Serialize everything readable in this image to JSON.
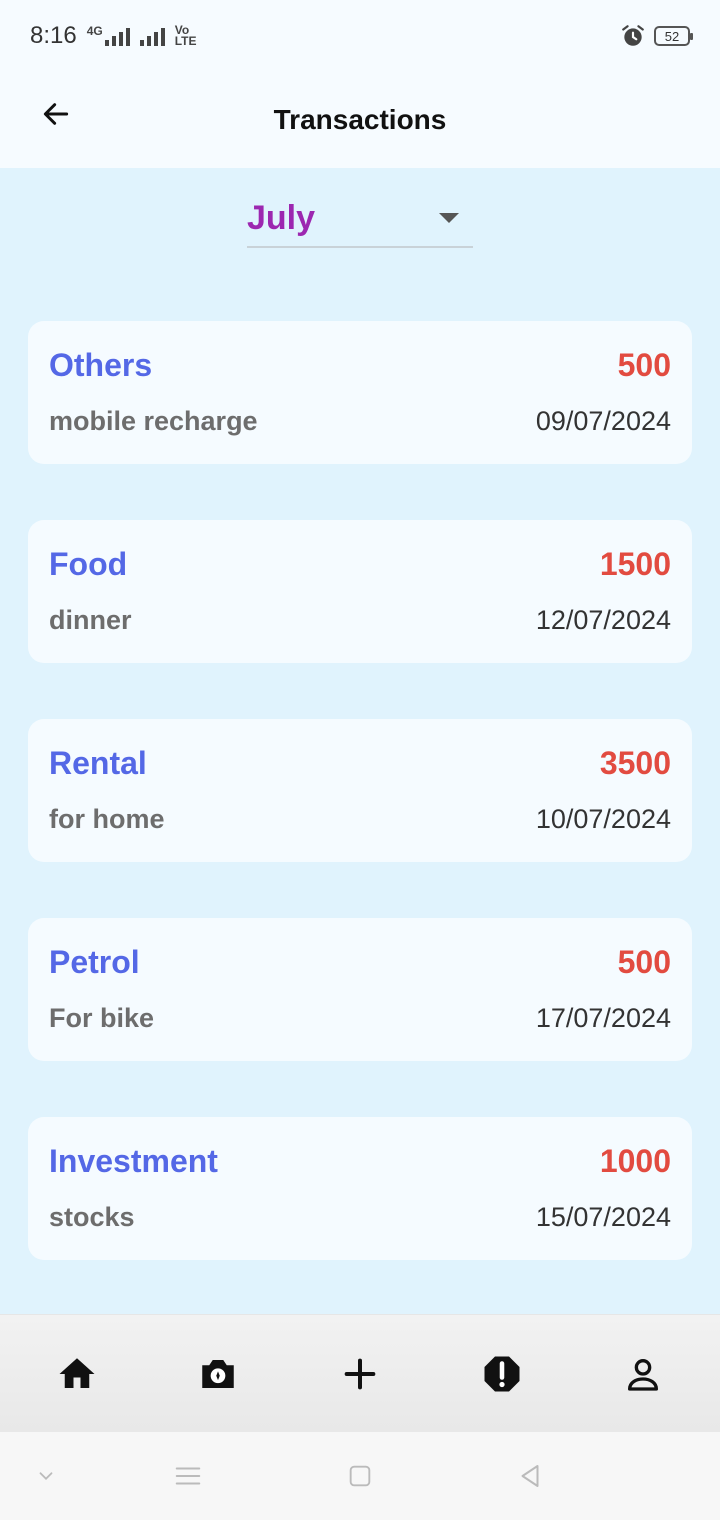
{
  "status_bar": {
    "time": "8:16",
    "network_label": "4G",
    "volte_label_top": "Vo",
    "volte_label_bottom": "LTE",
    "battery": "52"
  },
  "app_bar": {
    "title": "Transactions"
  },
  "month_filter": {
    "selected": "July"
  },
  "transactions": [
    {
      "category": "Others",
      "amount": "500",
      "note": "mobile recharge",
      "date": "09/07/2024"
    },
    {
      "category": "Food",
      "amount": "1500",
      "note": "dinner",
      "date": "12/07/2024"
    },
    {
      "category": "Rental",
      "amount": "3500",
      "note": "for home",
      "date": "10/07/2024"
    },
    {
      "category": "Petrol",
      "amount": "500",
      "note": "For bike",
      "date": "17/07/2024"
    },
    {
      "category": "Investment",
      "amount": "1000",
      "note": "stocks",
      "date": "15/07/2024"
    }
  ],
  "bottom_nav": [
    "home-icon",
    "camera-icon",
    "plus-icon",
    "alert-icon",
    "profile-icon"
  ],
  "colors": {
    "category": "#5468e6",
    "amount": "#e24b40",
    "month": "#9c27b0",
    "content_bg": "#e0f3fd"
  }
}
